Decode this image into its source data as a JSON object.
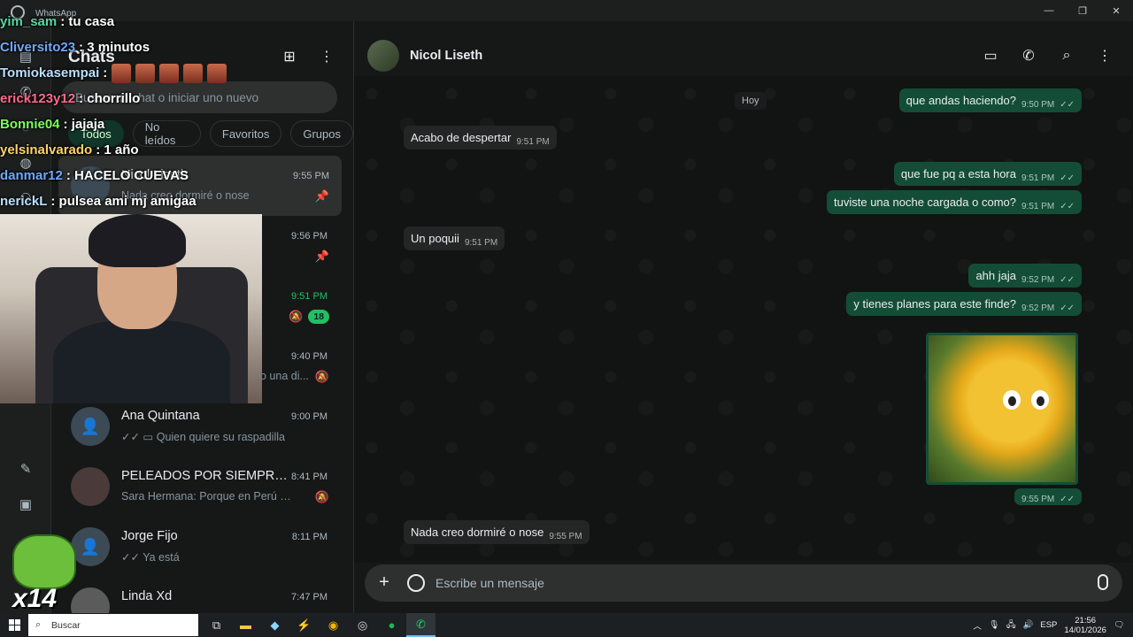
{
  "window": {
    "title": "WhatsApp"
  },
  "sidebar": {
    "title": "Chats",
    "search_placeholder": "Buscar un chat o iniciar uno nuevo",
    "filters": [
      "Todos",
      "No leídos",
      "Favoritos",
      "Grupos"
    ],
    "chats": [
      {
        "name": "Nicol Liseth",
        "time": "9:55 PM",
        "preview": "Nada creo dormiré o nose",
        "pinned": true,
        "selected": true
      },
      {
        "name": "",
        "time": "9:56 PM",
        "preview": "",
        "pinned": true
      },
      {
        "name": "",
        "time": "9:51 PM",
        "preview": "",
        "unread": "18",
        "muted": true
      },
      {
        "name": "",
        "time": "9:40 PM",
        "preview": "o una di...",
        "muted": true
      },
      {
        "name": "Ana Quintana",
        "time": "9:00 PM",
        "preview": "Quien quiere su raspadilla"
      },
      {
        "name": "PELEADOS POR SIEMPRE ...",
        "time": "8:41 PM",
        "preview": "Sara Hermana: Porque en Perú man...",
        "muted": true
      },
      {
        "name": "Jorge Fijo",
        "time": "8:11 PM",
        "preview": "Ya está"
      },
      {
        "name": "Linda Xd",
        "time": "7:47 PM",
        "preview": ""
      }
    ]
  },
  "conversation": {
    "contact_name": "Nicol Liseth",
    "day_separator": "Hoy",
    "messages": [
      {
        "dir": "out",
        "text": "que andas haciendo?",
        "time": "9:50 PM"
      },
      {
        "dir": "in",
        "text": "Acabo de despertar",
        "time": "9:51 PM"
      },
      {
        "dir": "out",
        "text": "que fue pq a esta hora",
        "time": "9:51 PM"
      },
      {
        "dir": "out",
        "text": "tuviste una noche cargada o como?",
        "time": "9:51 PM"
      },
      {
        "dir": "in",
        "text": "Un poquii",
        "time": "9:51 PM"
      },
      {
        "dir": "out",
        "text": "ahh jaja",
        "time": "9:52 PM"
      },
      {
        "dir": "out",
        "text": "y tienes planes para este finde?",
        "time": "9:52 PM"
      },
      {
        "dir": "out",
        "text": "",
        "time": "9:55 PM"
      },
      {
        "dir": "in",
        "text": "Nada creo dormiré o nose",
        "time": "9:55 PM"
      }
    ],
    "composer_placeholder": "Escribe un mensaje"
  },
  "overlay_chat": [
    {
      "user": "yim_sam",
      "msg": "tu casa",
      "color": "#5bd6a6"
    },
    {
      "user": "Cliversito23",
      "msg": "3 minutos",
      "color": "#6fa8ff"
    },
    {
      "user": "Tomiokasempai",
      "msg": "",
      "color": "#b8e0ff",
      "emotes": 5
    },
    {
      "user": "erick123y12",
      "msg": "chorrillo",
      "color": "#ff6b8b"
    },
    {
      "user": "Bonnie04",
      "msg": "jajaja",
      "color": "#7cff5a"
    },
    {
      "user": "yelsinalvarado",
      "msg": "1 año",
      "color": "#ffd36b"
    },
    {
      "user": "danmar12",
      "msg": "HACELO CUEVAS",
      "color": "#6fa8ff"
    },
    {
      "user": "nerickL",
      "msg": "pulsea ami mj amigaa",
      "color": "#b8e0ff"
    }
  ],
  "mascot": {
    "label": "x14"
  },
  "taskbar": {
    "search_label": "Buscar",
    "language": "ESP",
    "time": "21:56",
    "date": "14/01/2026"
  }
}
